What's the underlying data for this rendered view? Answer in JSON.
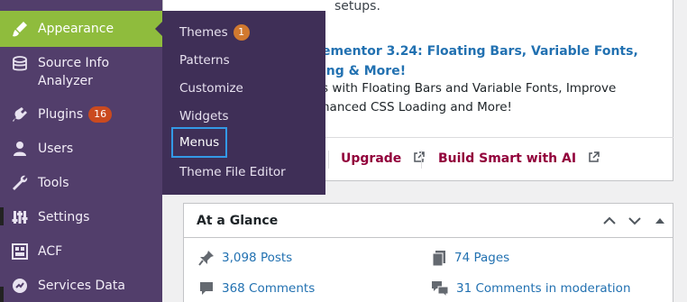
{
  "sidebar": {
    "items": [
      {
        "label": "Appearance",
        "icon": "paintbrush-icon",
        "active": true
      },
      {
        "label": "Source Info Analyzer",
        "line1": "Source Info",
        "line2": "Analyzer",
        "icon": "database-icon"
      },
      {
        "label": "Plugins",
        "icon": "plugin-icon",
        "badge": "16"
      },
      {
        "label": "Users",
        "icon": "user-icon"
      },
      {
        "label": "Tools",
        "icon": "wrench-icon"
      },
      {
        "label": "Settings",
        "icon": "settings-icon"
      },
      {
        "label": "ACF",
        "icon": "acf-icon"
      },
      {
        "label": "Services Data",
        "icon": "services-icon"
      }
    ]
  },
  "flyout": {
    "items": [
      {
        "label": "Themes",
        "badge": "1"
      },
      {
        "label": "Patterns"
      },
      {
        "label": "Customize"
      },
      {
        "label": "Widgets"
      },
      {
        "label": "Menus",
        "focused": true
      },
      {
        "label": "Theme File Editor"
      }
    ]
  },
  "news": {
    "top_snippet": "setups.",
    "title": "ementor 3.24: Floating Bars, Variable Fonts, …ing & More!",
    "title_line1": "ementor 3.24: Floating Bars, Variable Fonts,",
    "title_line2": "ing & More!",
    "desc_line1": "s with Floating Bars and Variable Fonts, Improve",
    "desc_line2": "nanced CSS Loading and More!"
  },
  "footer_links": {
    "upgrade": "Upgrade",
    "build": "Build Smart with AI"
  },
  "glance": {
    "title": "At a Glance",
    "posts": "3,098 Posts",
    "pages": "74 Pages",
    "comments": "368 Comments",
    "moderation": "31 Comments in moderation"
  },
  "colors": {
    "sidebar_bg": "#523e6b",
    "active_bg": "#8fbc3d",
    "flyout_bg": "#3f2f57",
    "link": "#2271b1",
    "elementor_link": "#92003b",
    "focus": "#3399e6"
  }
}
